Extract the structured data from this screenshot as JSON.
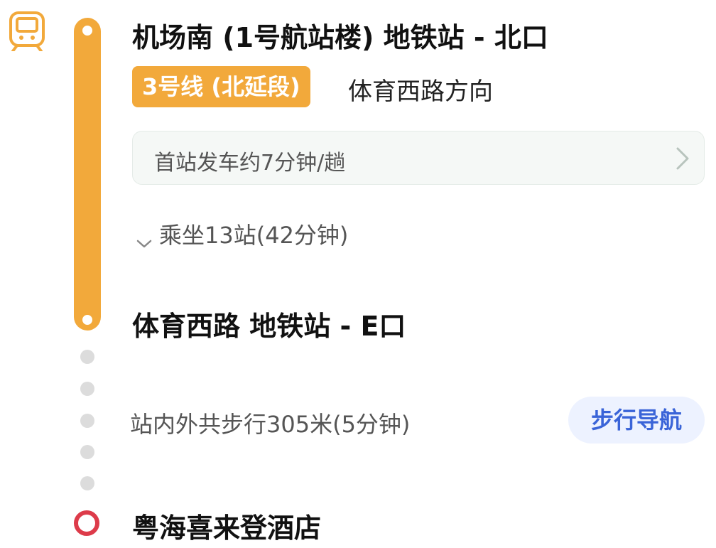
{
  "route": {
    "board_station": "机场南 (1号航站楼) 地铁站 - 北口",
    "line_badge": "3号线 (北延段)",
    "direction": "体育西路方向",
    "frequency": "首站发车约7分钟/趟",
    "ride_info": "乘坐13站(42分钟)",
    "alight_station": "体育西路 地铁站 - E口",
    "walk_info": "站内外共步行305米(5分钟)",
    "walk_nav_label": "步行导航",
    "destination": "粤海喜来登酒店"
  },
  "colors": {
    "line_color": "#f2a93b",
    "destination_color": "#dd3b4a",
    "nav_button_text": "#3a64d8",
    "nav_button_bg": "#edf2ff"
  },
  "icons": {
    "metro": "metro-train-icon",
    "frequency_more": "chevron-right-icon",
    "ride_expand": "chevron-down-icon"
  }
}
